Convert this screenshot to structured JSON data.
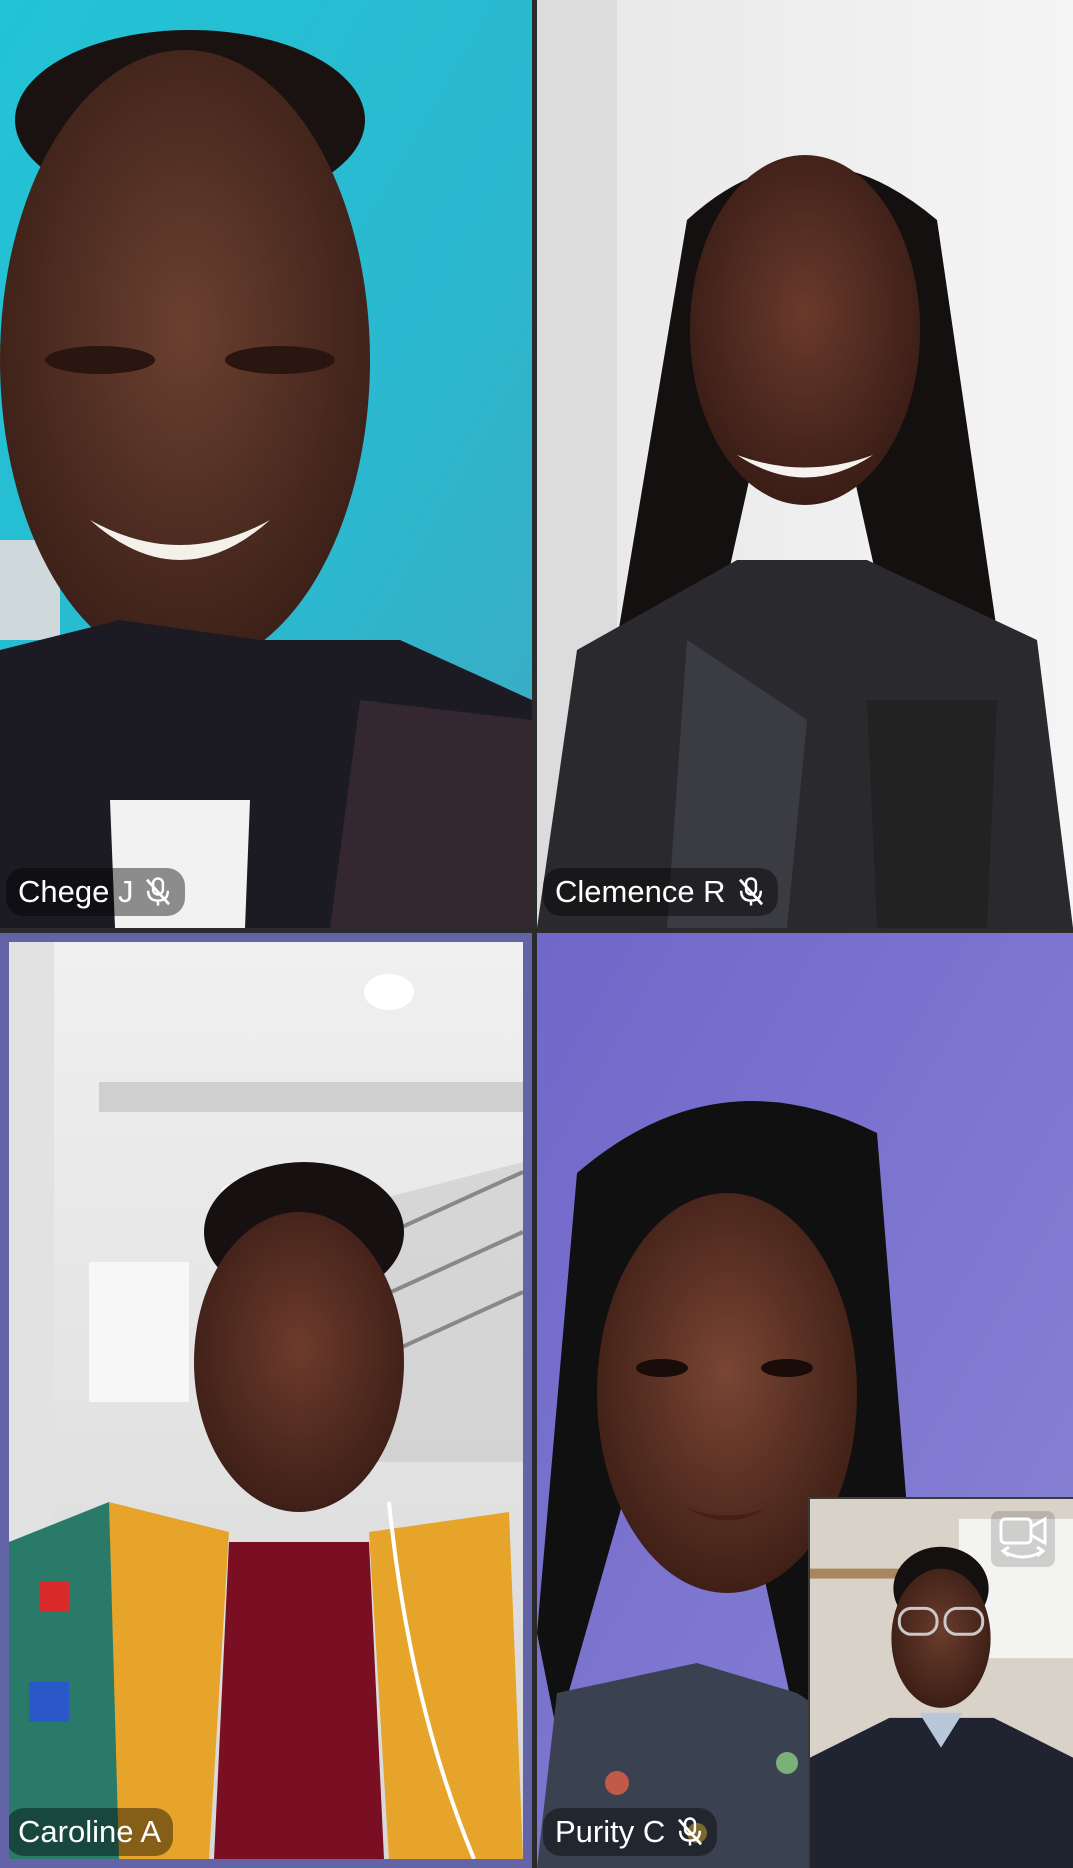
{
  "participants": [
    {
      "name": "Chege J",
      "muted": true,
      "mic_icon": "mic-off-icon"
    },
    {
      "name": "Clemence R",
      "muted": true,
      "mic_icon": "mic-off-icon"
    },
    {
      "name": "Caroline A",
      "muted": false,
      "active_speaker": true
    },
    {
      "name": "Purity C",
      "muted": true,
      "mic_icon": "mic-off-icon"
    }
  ],
  "self_view": {
    "switch_camera_icon": "switch-camera-icon"
  },
  "colors": {
    "active_speaker_border": "#6264a7",
    "background": "#2b2b2b"
  }
}
